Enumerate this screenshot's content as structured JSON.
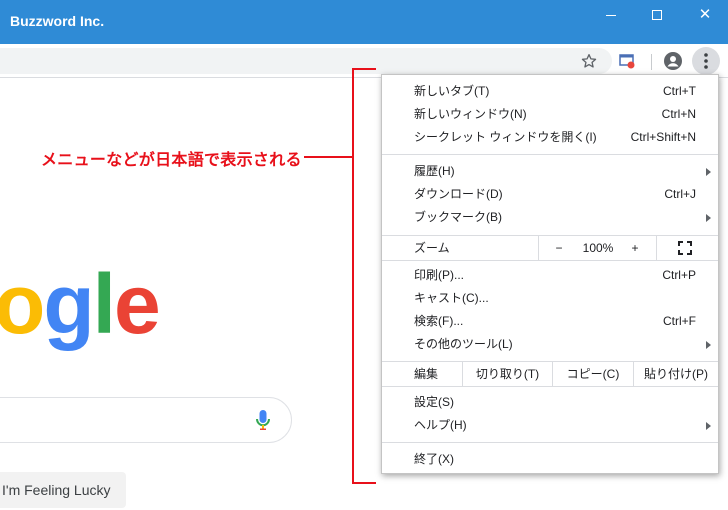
{
  "window": {
    "title": "Buzzword Inc.",
    "min_glyph": "",
    "close_glyph": "✕"
  },
  "toolbar": {
    "bookmark_icon": "star-icon",
    "extension_icon": "cast-extension-icon",
    "account_icon": "account-icon",
    "menu_icon": "vertical-dots-icon"
  },
  "page": {
    "logo_letters": [
      "o",
      "g",
      "l",
      "e"
    ],
    "logo_colors": [
      "#fbbc05",
      "#4285f4",
      "#34a853",
      "#ea4335"
    ],
    "lucky_button": "I'm Feeling Lucky"
  },
  "annotation": {
    "text": "メニューなどが日本語で表示される",
    "color": "#e8101a"
  },
  "menu": {
    "new_tab": {
      "label": "新しいタブ(T)",
      "shortcut": "Ctrl+T"
    },
    "new_window": {
      "label": "新しいウィンドウ(N)",
      "shortcut": "Ctrl+N"
    },
    "incognito": {
      "label": "シークレット ウィンドウを開く(I)",
      "shortcut": "Ctrl+Shift+N"
    },
    "history": {
      "label": "履歴(H)"
    },
    "downloads": {
      "label": "ダウンロード(D)",
      "shortcut": "Ctrl+J"
    },
    "bookmarks": {
      "label": "ブックマーク(B)"
    },
    "zoom": {
      "label": "ズーム",
      "minus": "−",
      "value": "100%",
      "plus": "+"
    },
    "print": {
      "label": "印刷(P)...",
      "shortcut": "Ctrl+P"
    },
    "cast": {
      "label": "キャスト(C)..."
    },
    "find": {
      "label": "検索(F)...",
      "shortcut": "Ctrl+F"
    },
    "more_tools": {
      "label": "その他のツール(L)"
    },
    "edit": {
      "label": "編集",
      "cut": "切り取り(T)",
      "copy": "コピー(C)",
      "paste": "貼り付け(P)"
    },
    "settings": {
      "label": "設定(S)"
    },
    "help": {
      "label": "ヘルプ(H)"
    },
    "exit": {
      "label": "終了(X)"
    }
  }
}
